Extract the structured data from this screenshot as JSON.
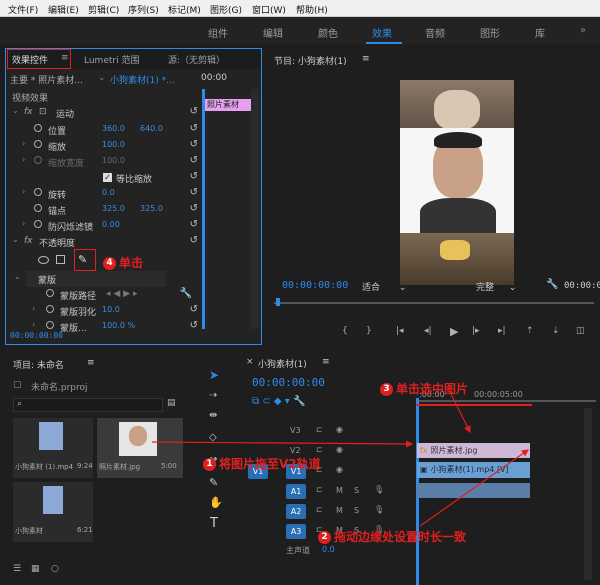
{
  "menu": [
    "文件(F)",
    "编辑(E)",
    "剪辑(C)",
    "序列(S)",
    "标记(M)",
    "图形(G)",
    "窗口(W)",
    "帮助(H)"
  ],
  "workspaces": [
    "组件",
    "编辑",
    "颜色",
    "效果",
    "音频",
    "图形",
    "库"
  ],
  "active_workspace": "效果",
  "effect_controls": {
    "tabs": [
      "效果控件",
      "Lumetri 范围",
      "源:（无剪辑）"
    ],
    "tab_menu_icon": "≡",
    "source_label": "主要 * 照片素材...",
    "sequence_label": "小狗素材(1) *...",
    "timecode_zero": "00:00",
    "video_effects": "视频效果",
    "motion": "运动",
    "position": "位置",
    "position_x": "360.0",
    "position_y": "640.0",
    "scale": "缩放",
    "scale_val": "100.0",
    "scale_width": "缩放宽度",
    "scale_width_val": "100.0",
    "uniform_scale": "等比缩放",
    "rotation": "旋转",
    "rotation_val": "0.0",
    "anchor": "锚点",
    "anchor_x": "325.0",
    "anchor_y": "325.0",
    "antiflicker": "防闪烁滤镜",
    "antiflicker_val": "0.00",
    "opacity": "不透明度",
    "mask": "蒙版",
    "mask_path": "蒙版路径",
    "mask_feather": "蒙版羽化",
    "mask_feather_val": "10.0",
    "mask_opacity": "蒙版...",
    "mask_opacity_val": "100.0 %",
    "clip_label": "照片素材",
    "bottom_timecode": "00:00:00:00"
  },
  "program": {
    "title": "节目: 小狗素材(1)",
    "menu_icon": "≡",
    "timecode": "00:00:00:00",
    "fit": "适合",
    "quality": "完整",
    "end_timecode": "00:00:05:00"
  },
  "project": {
    "title": "项目: 未命名",
    "menu_icon": "≡",
    "file": "未命名.prproj",
    "items": [
      {
        "name": "小狗素材 (1).mp4",
        "duration": "9:24"
      },
      {
        "name": "照片素材.jpg",
        "duration": "5:00"
      },
      {
        "name": "小狗素材",
        "duration": "6:21"
      }
    ]
  },
  "timeline": {
    "title": "小狗素材(1)",
    "menu_icon": "≡",
    "timecode": "00:00:00:00",
    "ruler_start": ":00:00",
    "ruler_mark": "00:00:05:00",
    "tracks": [
      "V3",
      "V2",
      "V1",
      "A1",
      "A2",
      "A3"
    ],
    "master": "主声道",
    "master_val": "0.0",
    "m_label": "M",
    "s_label": "S",
    "photo_clip": "照片素材.jpg",
    "video_clip": "小狗素材(1).mp4 [V]",
    "fx_label": "fx"
  },
  "annotations": {
    "a1": "将图片拖至V2轨道",
    "a2": "拖动边缘处设置时长一致",
    "a3": "单击选中图片",
    "a4": "单击",
    "n1": "1",
    "n2": "2",
    "n3": "3",
    "n4": "4"
  },
  "colors": {
    "accent": "#2d8ceb",
    "annotation": "#e02020",
    "clip_video": "#6a9fd4",
    "clip_photo": "#cf9fd8"
  }
}
